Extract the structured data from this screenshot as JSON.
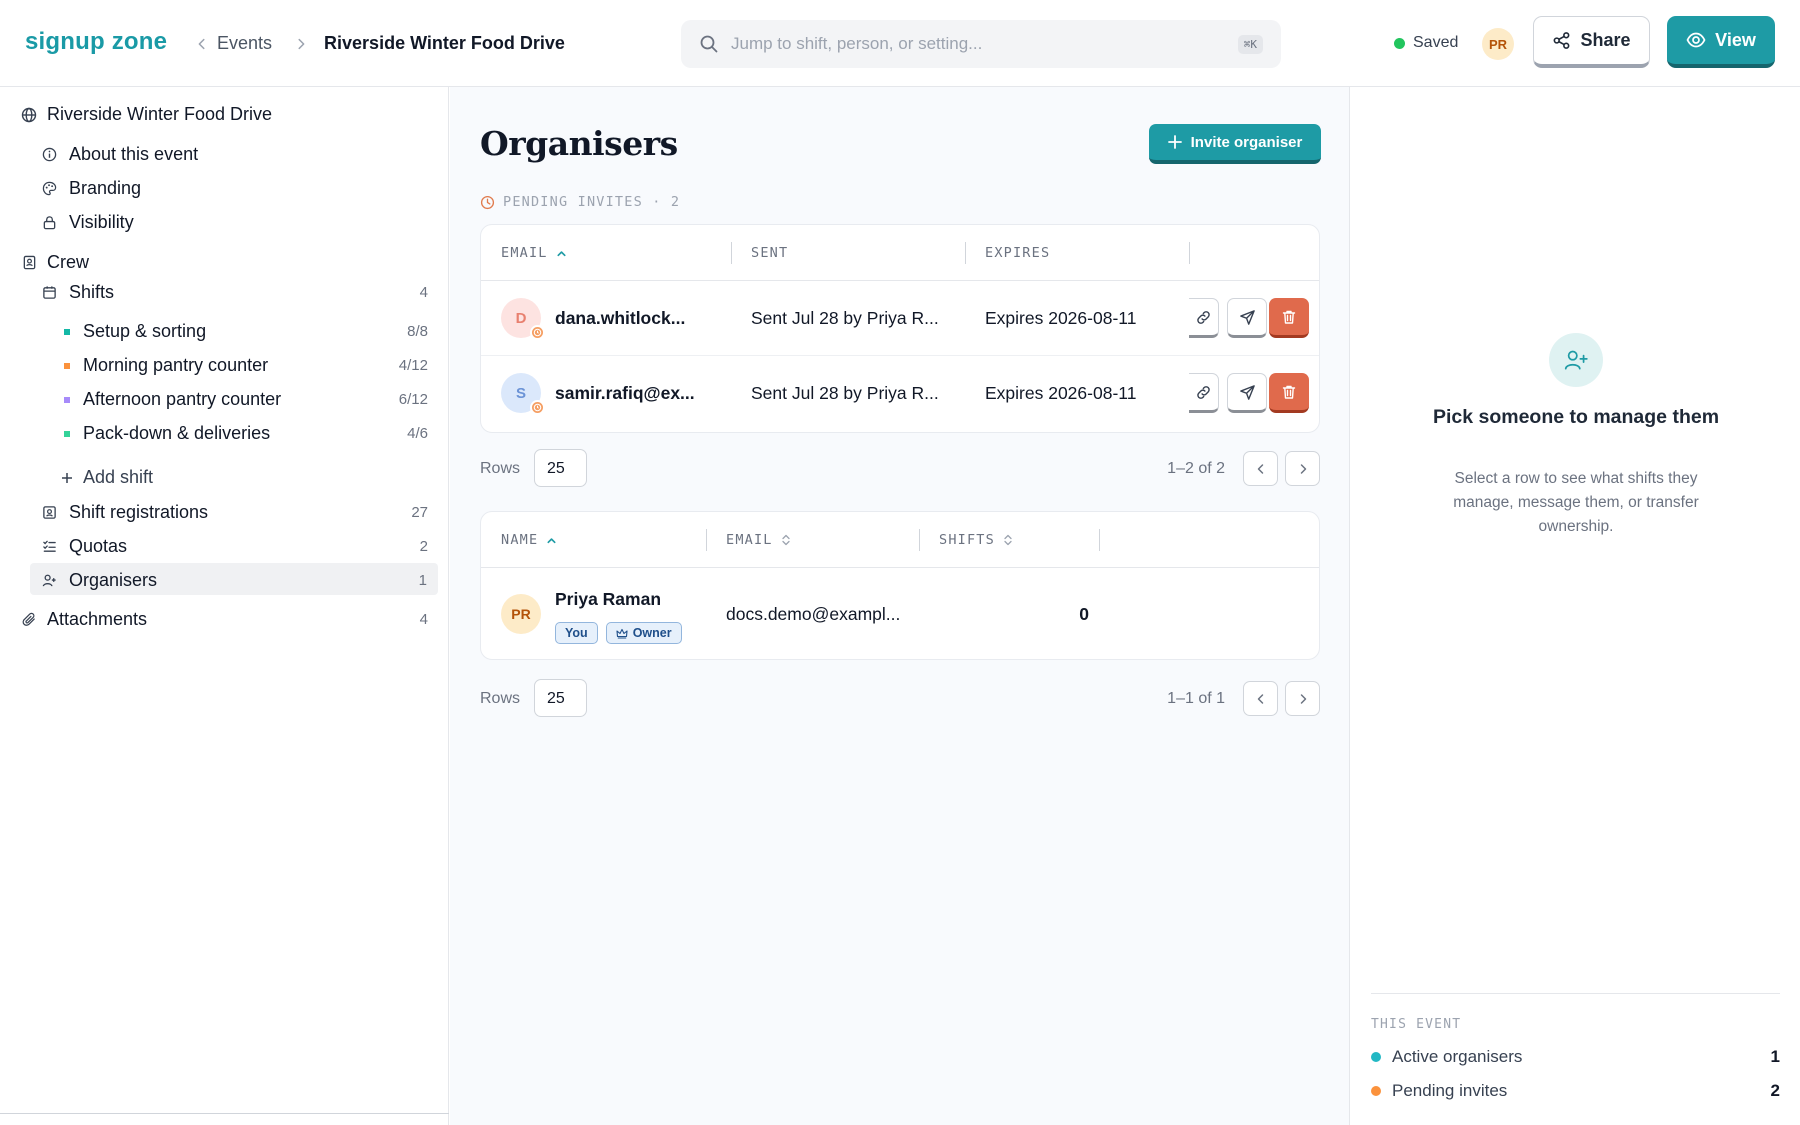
{
  "app": {
    "brand": "signup zone"
  },
  "breadcrumb": {
    "parent": "Events",
    "current": "Riverside Winter Food Drive"
  },
  "search": {
    "placeholder": "Jump to shift, person, or setting...",
    "shortcut": "⌘K"
  },
  "header": {
    "status": "Saved",
    "avatar_initials": "PR",
    "share_label": "Share",
    "view_label": "View"
  },
  "sidebar": {
    "event": "Riverside Winter Food Drive",
    "event_items": [
      "About this event",
      "Branding",
      "Visibility"
    ],
    "crew": "Crew",
    "shifts_label": "Shifts",
    "shifts_count": "4",
    "shift_list": [
      {
        "label": "Setup & sorting",
        "count": "8/8",
        "color": "#14b8a6"
      },
      {
        "label": "Morning pantry counter",
        "count": "4/12",
        "color": "#fb923c"
      },
      {
        "label": "Afternoon pantry counter",
        "count": "6/12",
        "color": "#a78bfa"
      },
      {
        "label": "Pack-down & deliveries",
        "count": "4/6",
        "color": "#34d399"
      }
    ],
    "add_shift": "Add shift",
    "registrations_label": "Shift registrations",
    "registrations_count": "27",
    "quotas_label": "Quotas",
    "quotas_count": "2",
    "organisers_label": "Organisers",
    "organisers_count": "1",
    "attachments_label": "Attachments",
    "attachments_count": "4"
  },
  "main": {
    "title": "Organisers",
    "invite_label": "Invite organiser",
    "pending_label": "PENDING INVITES · 2",
    "invites": {
      "columns": [
        "EMAIL",
        "SENT",
        "EXPIRES"
      ],
      "rows": [
        {
          "initial": "D",
          "email": "dana.whitlock...",
          "sent": "Sent Jul 28 by Priya R...",
          "expires": "Expires 2026-08-11"
        },
        {
          "initial": "S",
          "email": "samir.rafiq@ex...",
          "sent": "Sent Jul 28 by Priya R...",
          "expires": "Expires 2026-08-11"
        }
      ],
      "rows_label": "Rows",
      "rows_value": "25",
      "range": "1–2 of 2"
    },
    "organisers": {
      "columns": [
        "NAME",
        "EMAIL",
        "SHIFTS"
      ],
      "rows": [
        {
          "initials": "PR",
          "name": "Priya Raman",
          "tag_you": "You",
          "tag_owner": "Owner",
          "email": "docs.demo@exampl...",
          "shifts": "0"
        }
      ],
      "rows_label": "Rows",
      "rows_value": "25",
      "range": "1–1 of 1"
    }
  },
  "panel": {
    "title": "Pick someone to manage them",
    "text": "Select a row to see what shifts they manage, message them, or transfer ownership.",
    "section_label": "THIS EVENT",
    "stats": [
      {
        "label": "Active organisers",
        "value": "1",
        "color": "#22b8c4"
      },
      {
        "label": "Pending invites",
        "value": "2",
        "color": "#fb923c"
      }
    ]
  }
}
